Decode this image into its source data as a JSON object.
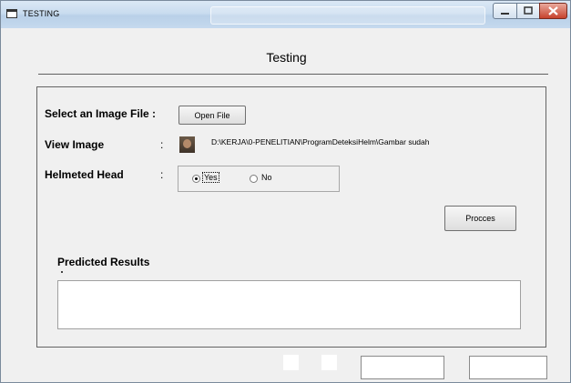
{
  "window": {
    "title": "TESTING",
    "app_icon": "window-icon",
    "controls": {
      "minimize_icon": "minimize-icon",
      "maximize_icon": "maximize-icon",
      "close_icon": "close-icon"
    }
  },
  "form": {
    "heading": "Testing",
    "select_image": {
      "label": "Select an Image File :",
      "button": "Open File"
    },
    "view_image": {
      "label": "View Image",
      "colon": ":",
      "file_path": "D:\\KERJA\\0-PENELITIAN\\ProgramDeteksiHelm\\Gambar sudah"
    },
    "helmeted_head": {
      "label": "Helmeted Head",
      "colon": ":",
      "options": [
        {
          "label": "Yes",
          "selected": true
        },
        {
          "label": "No",
          "selected": false
        }
      ]
    },
    "process_button": "Procces",
    "predicted_results": {
      "label": "Predicted Results",
      "value": ""
    }
  },
  "status": {
    "field_1": "",
    "field_2": ""
  },
  "colors": {
    "window_bg": "#f0f0f0",
    "close_button": "#c7422c",
    "titlebar": "#c9dcef"
  }
}
